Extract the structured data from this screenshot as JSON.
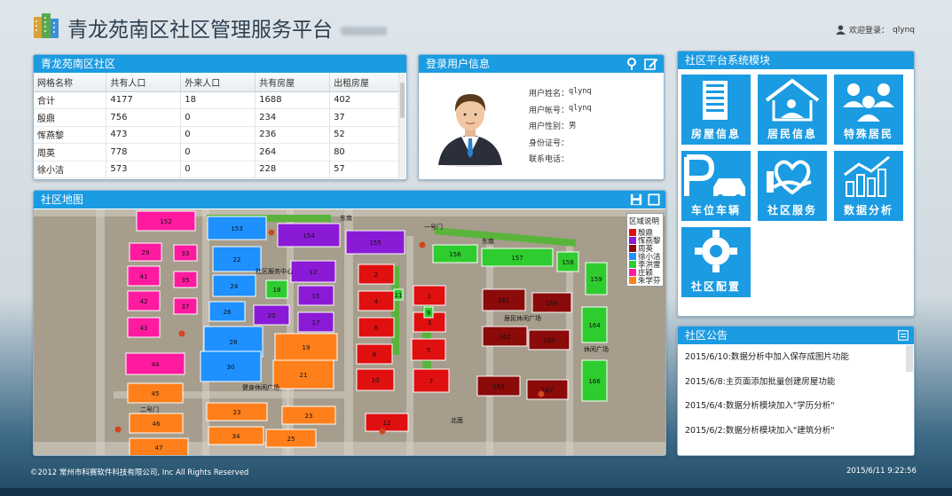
{
  "header": {
    "title": "青龙苑南区社区管理服务平台",
    "login_label": "欢迎登录：",
    "login_user": "qlynq"
  },
  "stats": {
    "title": "青龙苑南区社区",
    "columns": [
      "网格名称",
      "共有人口",
      "外来人口",
      "共有房屋",
      "出租房屋"
    ],
    "rows": [
      [
        "合计",
        "4177",
        "18",
        "1688",
        "402"
      ],
      [
        "殷鼎",
        "756",
        "0",
        "234",
        "37"
      ],
      [
        "恽燕黎",
        "473",
        "0",
        "236",
        "52"
      ],
      [
        "周英",
        "778",
        "0",
        "264",
        "80"
      ],
      [
        "徐小洁",
        "573",
        "0",
        "228",
        "57"
      ]
    ]
  },
  "user": {
    "title": "登录用户信息",
    "fields": [
      {
        "label": "用户姓名：",
        "value": "qlynq"
      },
      {
        "label": "用户帐号：",
        "value": "qlynq"
      },
      {
        "label": "用户性别：",
        "value": "男"
      },
      {
        "label": "身份证号：",
        "value": ""
      },
      {
        "label": "联系电话：",
        "value": ""
      }
    ]
  },
  "modules": {
    "title": "社区平台系统模块",
    "tiles": [
      {
        "label": "房屋信息",
        "icon": "building-icon"
      },
      {
        "label": "居民信息",
        "icon": "home-person-icon"
      },
      {
        "label": "特殊居民",
        "icon": "people-group-icon"
      },
      {
        "label": "车位车辆",
        "icon": "parking-car-icon"
      },
      {
        "label": "社区服务",
        "icon": "heart-hand-icon"
      },
      {
        "label": "数据分析",
        "icon": "bar-chart-icon"
      },
      {
        "label": "社区配置",
        "icon": "gear-icon"
      }
    ]
  },
  "map": {
    "title": "社区地图",
    "legend_title": "区域说明",
    "legend": [
      {
        "name": "殷鼎",
        "color": "#e01010"
      },
      {
        "name": "恽燕黎",
        "color": "#8a1ad6"
      },
      {
        "name": "周英",
        "color": "#8b0a0a"
      },
      {
        "name": "徐小洁",
        "color": "#1e90ff"
      },
      {
        "name": "李洪雷",
        "color": "#2ecc2e"
      },
      {
        "name": "庄颖",
        "color": "#ff1aa0"
      },
      {
        "name": "朱学芬",
        "color": "#ff7f1a"
      }
    ],
    "labels": {
      "service_center": "社区服务中心",
      "fitness_square": "健身休闲广场",
      "resident_square": "居民休闲广场",
      "leisure_square": "休闲广场",
      "gate1": "一号门",
      "gate2": "二号门",
      "road1": "东南",
      "road2": "东南",
      "north_road": "北面"
    },
    "buildings": [
      {
        "n": "152",
        "c": "#ff1aa0"
      },
      {
        "n": "153",
        "c": "#1e90ff"
      },
      {
        "n": "154",
        "c": "#8a1ad6"
      },
      {
        "n": "155",
        "c": "#8a1ad6"
      },
      {
        "n": "156",
        "c": "#2ecc2e"
      },
      {
        "n": "157",
        "c": "#2ecc2e"
      },
      {
        "n": "158",
        "c": "#2ecc2e"
      },
      {
        "n": "159",
        "c": "#2ecc2e"
      },
      {
        "n": "29",
        "c": "#ff1aa0"
      },
      {
        "n": "33",
        "c": "#ff1aa0"
      },
      {
        "n": "41",
        "c": "#ff1aa0"
      },
      {
        "n": "35",
        "c": "#ff1aa0"
      },
      {
        "n": "42",
        "c": "#ff1aa0"
      },
      {
        "n": "37",
        "c": "#ff1aa0"
      },
      {
        "n": "43",
        "c": "#ff1aa0"
      },
      {
        "n": "44",
        "c": "#ff1aa0"
      },
      {
        "n": "22",
        "c": "#1e90ff"
      },
      {
        "n": "24",
        "c": "#1e90ff"
      },
      {
        "n": "26",
        "c": "#1e90ff"
      },
      {
        "n": "28",
        "c": "#1e90ff"
      },
      {
        "n": "30",
        "c": "#1e90ff"
      },
      {
        "n": "12",
        "c": "#8a1ad6"
      },
      {
        "n": "15",
        "c": "#8a1ad6"
      },
      {
        "n": "18",
        "c": "#2ecc2e"
      },
      {
        "n": "20",
        "c": "#8a1ad6"
      },
      {
        "n": "17",
        "c": "#8a1ad6"
      },
      {
        "n": "19",
        "c": "#ff7f1a"
      },
      {
        "n": "21",
        "c": "#ff7f1a"
      },
      {
        "n": "45",
        "c": "#ff7f1a"
      },
      {
        "n": "46",
        "c": "#ff7f1a"
      },
      {
        "n": "47",
        "c": "#ff7f1a"
      },
      {
        "n": "23",
        "c": "#ff7f1a"
      },
      {
        "n": "23",
        "c": "#ff7f1a"
      },
      {
        "n": "34",
        "c": "#ff7f1a"
      },
      {
        "n": "25",
        "c": "#ff7f1a"
      },
      {
        "n": "2",
        "c": "#e01010"
      },
      {
        "n": "4",
        "c": "#e01010"
      },
      {
        "n": "6",
        "c": "#e01010"
      },
      {
        "n": "8",
        "c": "#e01010"
      },
      {
        "n": "10",
        "c": "#e01010"
      },
      {
        "n": "1",
        "c": "#e01010"
      },
      {
        "n": "3",
        "c": "#e01010"
      },
      {
        "n": "5",
        "c": "#e01010"
      },
      {
        "n": "7",
        "c": "#e01010"
      },
      {
        "n": "12",
        "c": "#e01010"
      },
      {
        "n": "161",
        "c": "#8b0a0a"
      },
      {
        "n": "160",
        "c": "#8b0a0a"
      },
      {
        "n": "162",
        "c": "#8b0a0a"
      },
      {
        "n": "163",
        "c": "#8b0a0a"
      },
      {
        "n": "165",
        "c": "#8b0a0a"
      },
      {
        "n": "167",
        "c": "#8b0a0a"
      },
      {
        "n": "164",
        "c": "#2ecc2e"
      },
      {
        "n": "166",
        "c": "#2ecc2e"
      },
      {
        "n": "11",
        "c": "#2ecc2e"
      },
      {
        "n": "9",
        "c": "#2ecc2e"
      }
    ]
  },
  "notices": {
    "title": "社区公告",
    "items": [
      "2015/6/10:数据分析中加入保存成图片功能",
      "2015/6/8:主页面添加批量创建房屋功能",
      "2015/6/4:数据分析模块加入\"学历分析\"",
      "2015/6/2:数据分析模块加入\"建筑分析\""
    ]
  },
  "footer": {
    "copyright": "©2012 常州市科赛软件科技有限公司, Inc All Rights Reserved",
    "datetime": "2015/6/11 9:22:56"
  }
}
